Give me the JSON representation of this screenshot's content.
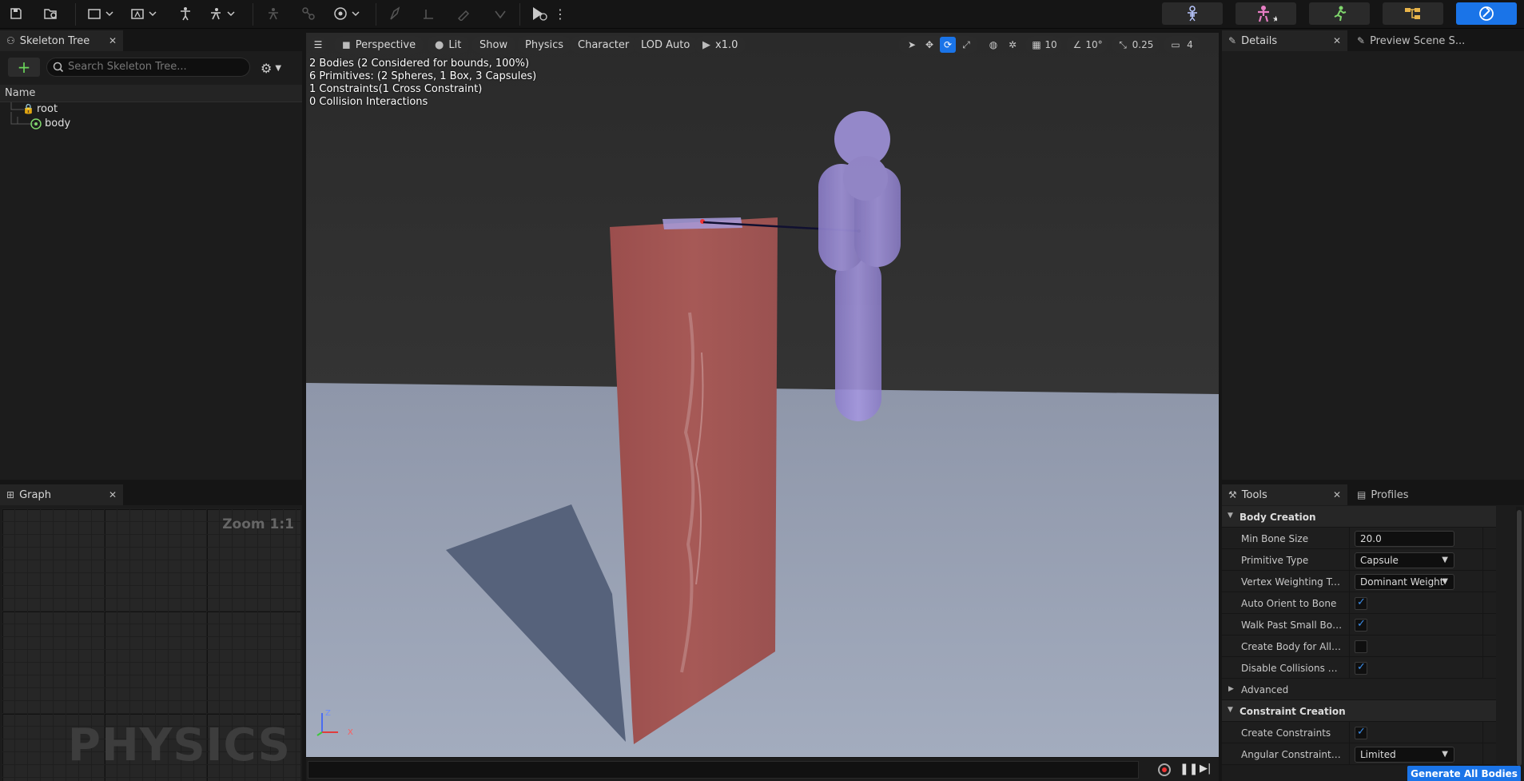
{
  "toolbar": {
    "icons": [
      "save-icon",
      "browse-icon",
      "preview-mesh-icon",
      "preview-anim-icon",
      "character-icon",
      "physics-add-icon",
      "simulate-icon",
      "play-icon"
    ]
  },
  "skeleton_tree": {
    "tab_label": "Skeleton Tree",
    "search_placeholder": "Search Skeleton Tree...",
    "column_name": "Name",
    "nodes": [
      {
        "label": "root"
      },
      {
        "label": "body"
      }
    ]
  },
  "graph": {
    "tab_label": "Graph",
    "zoom_label": "Zoom 1:1",
    "watermark": "PHYSICS"
  },
  "viewport": {
    "chips": {
      "perspective": "Perspective",
      "lit": "Lit",
      "show": "Show",
      "physics": "Physics",
      "character": "Character",
      "lod": "LOD Auto",
      "speed": "x1.0"
    },
    "right_toolbar": {
      "grid_value": "10",
      "angle_value": "10°",
      "scale_value": "0.25",
      "camera_value": "4"
    },
    "stats": [
      "2 Bodies (2 Considered for bounds, 100%)",
      "6 Primitives: (2 Spheres, 1 Box, 3 Capsules)",
      "1 Constraints(1 Cross Constraint)",
      "0 Collision Interactions"
    ],
    "axis": {
      "z": "Z",
      "x": "X"
    }
  },
  "details": {
    "tab_label": "Details",
    "preview_tab_label": "Preview Scene S..."
  },
  "tools": {
    "tab_label": "Tools",
    "profiles_tab_label": "Profiles",
    "body_creation": {
      "header": "Body Creation",
      "min_bone_size_label": "Min Bone Size",
      "min_bone_size_value": "20.0",
      "primitive_type_label": "Primitive Type",
      "primitive_type_value": "Capsule",
      "vertex_weighting_label": "Vertex Weighting Type",
      "vertex_weighting_value": "Dominant Weight",
      "auto_orient_label": "Auto Orient to Bone",
      "auto_orient_checked": true,
      "walk_past_label": "Walk Past Small Bones",
      "walk_past_checked": true,
      "create_body_all_label": "Create Body for All Bo...",
      "create_body_all_checked": false,
      "disable_collisions_label": "Disable Collisions by D...",
      "disable_collisions_checked": true
    },
    "advanced_label": "Advanced",
    "constraint_creation": {
      "header": "Constraint Creation",
      "create_constraints_label": "Create Constraints",
      "create_constraints_checked": true,
      "angular_mode_label": "Angular Constraint Mo...",
      "angular_mode_value": "Limited"
    },
    "generate_button": "Generate All Bodies"
  },
  "colors": {
    "accent": "#1a74e8",
    "cloth": "#a35452",
    "capsule": "#9e8fd6",
    "floor": "#8c95aa"
  }
}
